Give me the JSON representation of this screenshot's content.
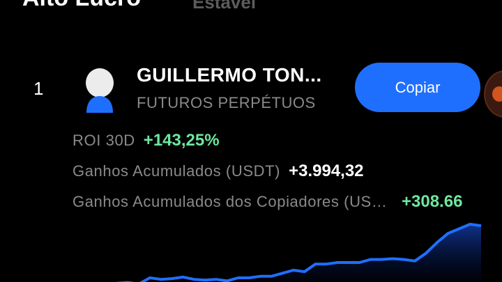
{
  "tabs": [
    {
      "label": "Alto Lucro",
      "active": true
    },
    {
      "label": "Estável",
      "active": false
    }
  ],
  "trader": {
    "rank": "1",
    "name": "GUILLERMO TON...",
    "category": "FUTUROS PERPÉTUOS",
    "copy_label": "Copiar",
    "avatar_icon": "user-avatar-icon"
  },
  "stats": {
    "roi_label": "ROI 30D",
    "roi_value": "+143,25%",
    "pnl_label": "Ganhos Acumulados (USDT)",
    "pnl_value": "+3.994,32",
    "copier_label": "Ganhos Acumulados dos Copiadores (USDT)",
    "copier_value": "+308.66"
  },
  "colors": {
    "accent_blue": "#1f6fff",
    "positive_green": "#6ee7a0",
    "muted_text": "#8a8a8a",
    "background": "#000000"
  },
  "sparkline": {
    "values": [
      7,
      8,
      7.5,
      8.5,
      9,
      8,
      12,
      11,
      11.5,
      12.5,
      11,
      10.5,
      11,
      10,
      12,
      12,
      13,
      13,
      15,
      17,
      16,
      21,
      21,
      22,
      22,
      22,
      24,
      24,
      24.5,
      24,
      23,
      28,
      35,
      41,
      44,
      47,
      46
    ]
  }
}
